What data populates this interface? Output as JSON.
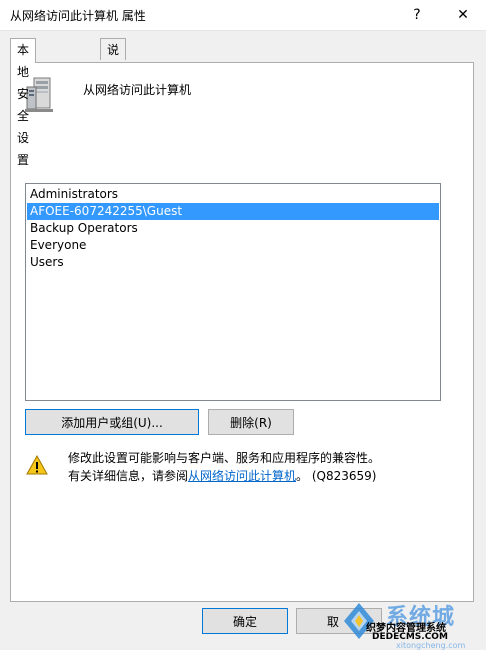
{
  "window": {
    "title": "从网络访问此计算机 属性",
    "help_glyph": "?",
    "close_glyph": "✕"
  },
  "tabs": [
    {
      "label": "本地安全设置",
      "active": true
    },
    {
      "label": "说明",
      "active": false
    }
  ],
  "policy": {
    "name": "从网络访问此计算机",
    "icon": "computer-icon"
  },
  "members": {
    "items": [
      {
        "label": "Administrators",
        "selected": false
      },
      {
        "label": "AFOEE-607242255\\Guest",
        "selected": true
      },
      {
        "label": "Backup Operators",
        "selected": false
      },
      {
        "label": "Everyone",
        "selected": false
      },
      {
        "label": "Users",
        "selected": false
      }
    ]
  },
  "buttons": {
    "add_label": "添加用户或组(U)...",
    "remove_label": "删除(R)",
    "ok_label": "确定",
    "cancel_label": "取"
  },
  "warning": {
    "icon": "warning-icon",
    "line1": "修改此设置可能影响与客户端、服务和应用程序的兼容性。",
    "line2_prefix": "有关详细信息，请参阅",
    "link": "从网络访问此计算机",
    "line2_suffix": "。 (Q823659)"
  },
  "watermark": {
    "brand": "系统城",
    "line1": "织梦内容管理系统",
    "line2": "DEDECMS.COM",
    "line3": "xitongcheng.com"
  },
  "colors": {
    "selection": "#3399ff",
    "link": "#0066cc",
    "default_button_border": "#0078d7"
  }
}
